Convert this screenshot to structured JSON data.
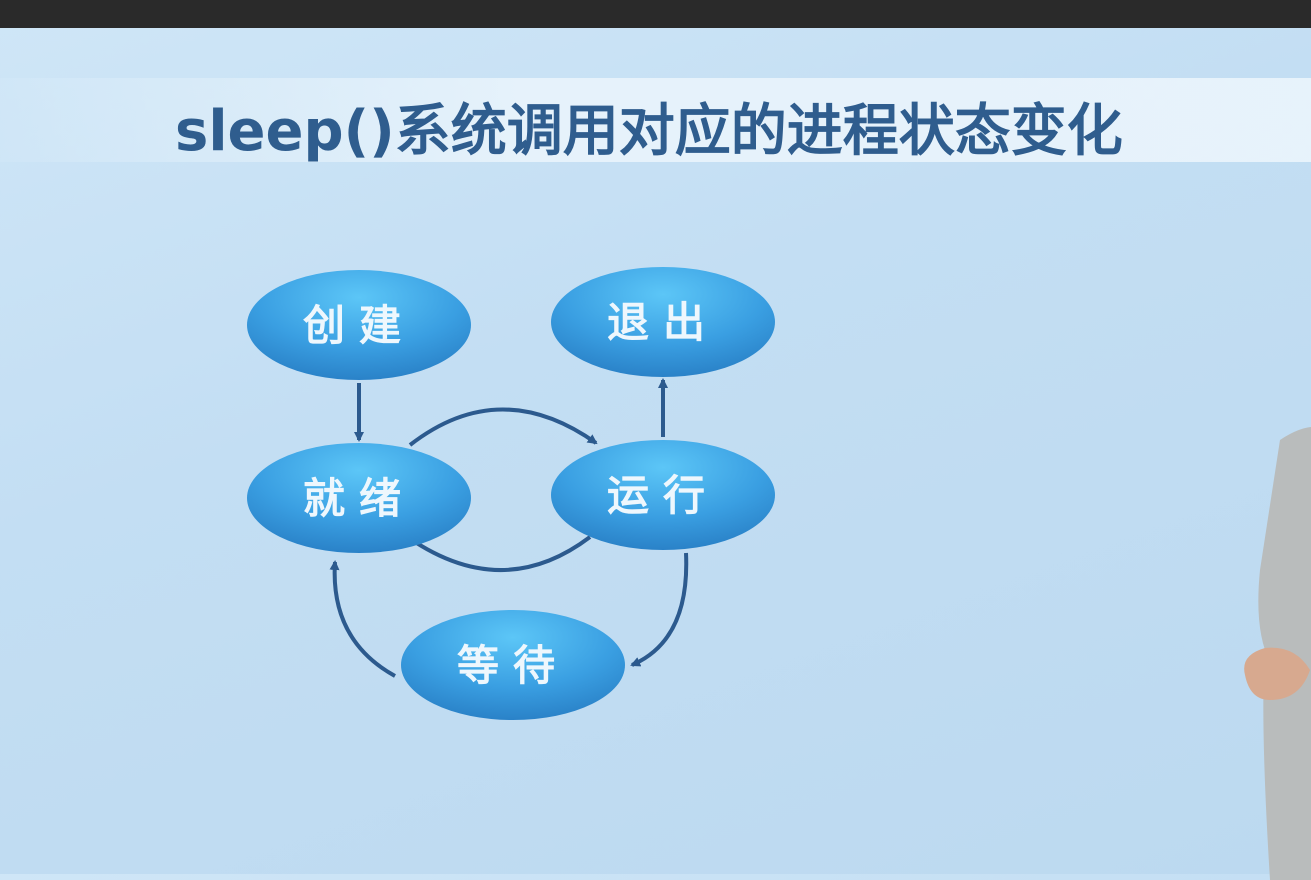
{
  "title": "sleep()系统调用对应的进程状态变化",
  "colors": {
    "node": "#3fa4e6",
    "arrow": "#2c5a8e",
    "title": "#2f5d8e"
  },
  "nodes": [
    {
      "id": "create",
      "label": "创建"
    },
    {
      "id": "exit",
      "label": "退出"
    },
    {
      "id": "ready",
      "label": "就绪"
    },
    {
      "id": "running",
      "label": "运行"
    },
    {
      "id": "waiting",
      "label": "等待"
    }
  ],
  "edges": [
    {
      "from": "create",
      "to": "ready"
    },
    {
      "from": "ready",
      "to": "running"
    },
    {
      "from": "running",
      "to": "ready"
    },
    {
      "from": "running",
      "to": "exit"
    },
    {
      "from": "running",
      "to": "waiting"
    },
    {
      "from": "waiting",
      "to": "ready"
    }
  ]
}
